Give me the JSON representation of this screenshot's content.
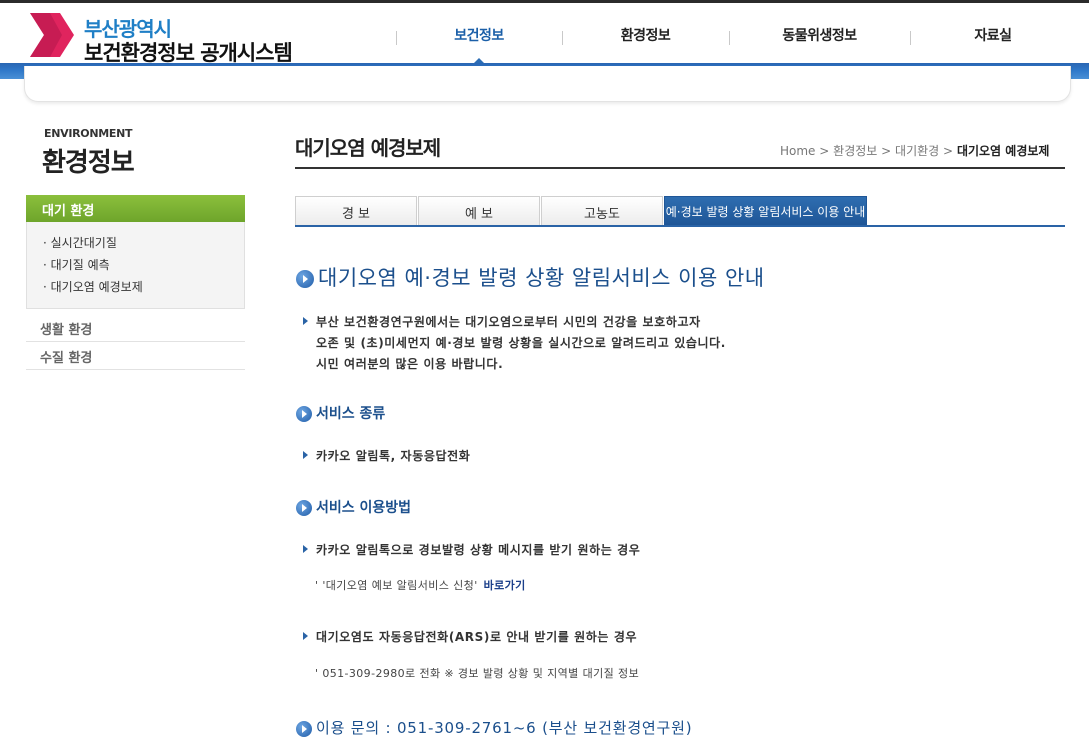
{
  "header": {
    "logo_line1": "부산광역시",
    "logo_line2": "보건환경정보 공개시스템",
    "nav": [
      {
        "label": "보건정보",
        "active": true
      },
      {
        "label": "환경정보",
        "active": false
      },
      {
        "label": "동물위생정보",
        "active": false
      },
      {
        "label": "자료실",
        "active": false
      }
    ],
    "brand_color": "#2f78c9",
    "logo_color": "#e0245e"
  },
  "sidebar": {
    "eng_label": "ENVIRONMENT",
    "title": "환경정보",
    "active_section": "대기 환경",
    "sub_items": [
      "· 실시간대기질",
      "· 대기질 예측",
      "· 대기오염 예경보제"
    ],
    "other_sections": [
      "생활 환경",
      "수질 환경"
    ],
    "accent_color": "#7bb235"
  },
  "main": {
    "page_title": "대기오염 예경보제",
    "breadcrumb": {
      "items": [
        "Home",
        "환경정보",
        "대기환경"
      ],
      "separator": ">",
      "current": "대기오염 예경보제"
    },
    "tabs": [
      {
        "label": "경   보",
        "active": false
      },
      {
        "label": "예   보",
        "active": false
      },
      {
        "label": "고농도",
        "active": false
      },
      {
        "label": "예·경보 발령 상황 알림서비스 이용 안내",
        "active": true
      }
    ],
    "heading": "대기오염 예·경보 발령 상황 알림서비스 이용 안내",
    "intro": [
      "부산 보건환경연구원에서는 대기오염으로부터 시민의 건강을 보호하고자",
      "오존 및 (초)미세먼지 예·경보 발령 상황을 실시간으로 알려드리고 있습니다.",
      "시민 여러분의 많은 이용 바랍니다."
    ],
    "service_type": {
      "heading": "서비스 종류",
      "text": "카카오 알림톡, 자동응답전화"
    },
    "usage": {
      "heading": "서비스 이용방법",
      "kakao_text": "카카오 알림톡으로 경보발령 상황 메시지를 받기 원하는 경우",
      "kakao_detail": "' '대기오염 예보 알림서비스 신청'",
      "kakao_link": "바로가기",
      "ars_text": "대기오염도 자동응답전화(ARS)로 안내 받기를 원하는 경우",
      "ars_detail": "' 051-309-2980로 전화 ※ 경보 발령 상황 및 지역별 대기질 정보"
    },
    "inquiry": "이용 문의 : 051-309-2761~6 (부산 보건환경연구원)"
  }
}
